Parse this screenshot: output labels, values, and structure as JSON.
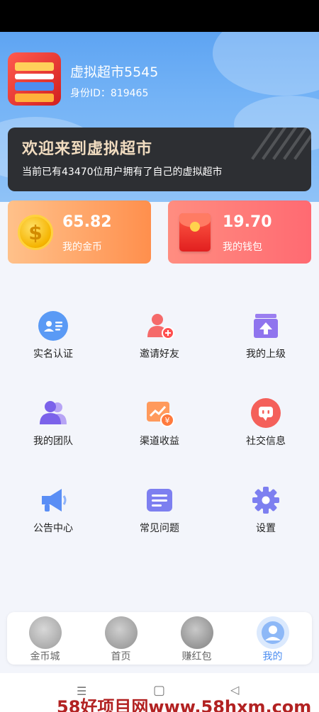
{
  "profile": {
    "name": "虚拟超市5545",
    "id_label": "身份ID：",
    "id_value": "819465"
  },
  "banner": {
    "title": "欢迎来到虚拟超市",
    "subtitle": "当前已有43470位用户拥有了自己的虚拟超市"
  },
  "cards": {
    "gold": {
      "value": "65.82",
      "label": "我的金币",
      "coin_symbol": "$"
    },
    "wallet": {
      "value": "19.70",
      "label": "我的钱包"
    }
  },
  "menu": [
    {
      "label": "实名认证",
      "icon": "id-card-icon"
    },
    {
      "label": "邀请好友",
      "icon": "add-user-icon"
    },
    {
      "label": "我的上级",
      "icon": "upload-box-icon"
    },
    {
      "label": "我的团队",
      "icon": "team-icon"
    },
    {
      "label": "渠道收益",
      "icon": "income-chart-icon"
    },
    {
      "label": "社交信息",
      "icon": "chat-bubble-icon"
    },
    {
      "label": "公告中心",
      "icon": "megaphone-icon"
    },
    {
      "label": "常见问题",
      "icon": "faq-doc-icon"
    },
    {
      "label": "设置",
      "icon": "gear-icon"
    }
  ],
  "tabs": [
    {
      "label": "金币城",
      "icon": "coin-city-icon"
    },
    {
      "label": "首页",
      "icon": "home-icon"
    },
    {
      "label": "赚红包",
      "icon": "red-envelope-icon"
    },
    {
      "label": "我的",
      "icon": "profile-icon"
    }
  ],
  "active_tab": 3,
  "system_nav": {
    "menu": "☰",
    "home": "▢",
    "back": "◁"
  },
  "watermark": "58好项目网www.58hxm.com",
  "colors": {
    "accent": "#4a8cf0",
    "hero": "#6aaef5",
    "gold_card": "#ff8f4d",
    "wallet_card": "#ff6a72",
    "banner_title": "#f1dcc0"
  }
}
